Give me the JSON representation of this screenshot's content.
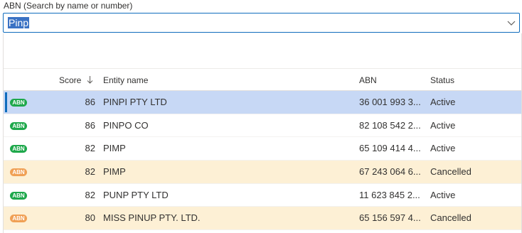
{
  "field": {
    "label": "ABN (Search by name or number)",
    "value": "Pinp"
  },
  "table": {
    "headers": {
      "score": "Score",
      "entity": "Entity name",
      "abn": "ABN",
      "status": "Status"
    },
    "rows": [
      {
        "badge": "ABN",
        "score": "86",
        "name": "PINPI PTY LTD",
        "abn": "36 001 993 3...",
        "status": "Active",
        "state": "active",
        "selected": true
      },
      {
        "badge": "ABN",
        "score": "86",
        "name": "PINPO CO",
        "abn": "82 108 542 2...",
        "status": "Active",
        "state": "active",
        "selected": false
      },
      {
        "badge": "ABN",
        "score": "82",
        "name": "PIMP",
        "abn": "65 109 414 4...",
        "status": "Active",
        "state": "active",
        "selected": false
      },
      {
        "badge": "ABN",
        "score": "82",
        "name": "PIMP",
        "abn": "67 243 064 6...",
        "status": "Cancelled",
        "state": "cancelled",
        "selected": false
      },
      {
        "badge": "ABN",
        "score": "82",
        "name": "PUNP PTY LTD",
        "abn": "11 623 845 2...",
        "status": "Active",
        "state": "active",
        "selected": false
      },
      {
        "badge": "ABN",
        "score": "80",
        "name": "MISS PINUP PTY. LTD.",
        "abn": "65 156 597 4...",
        "status": "Cancelled",
        "state": "cancelled",
        "selected": false
      }
    ]
  },
  "colors": {
    "accent": "#0f6cbd",
    "selected_row": "#c7d8f5",
    "cancelled_row": "#fdf0d5",
    "active_badge": "#1ea84b",
    "cancelled_badge": "#f0a055"
  },
  "icons": {
    "sort": "arrow-down-icon",
    "dropdown": "chevron-down-icon",
    "status_badge": "abn-badge-icon"
  }
}
